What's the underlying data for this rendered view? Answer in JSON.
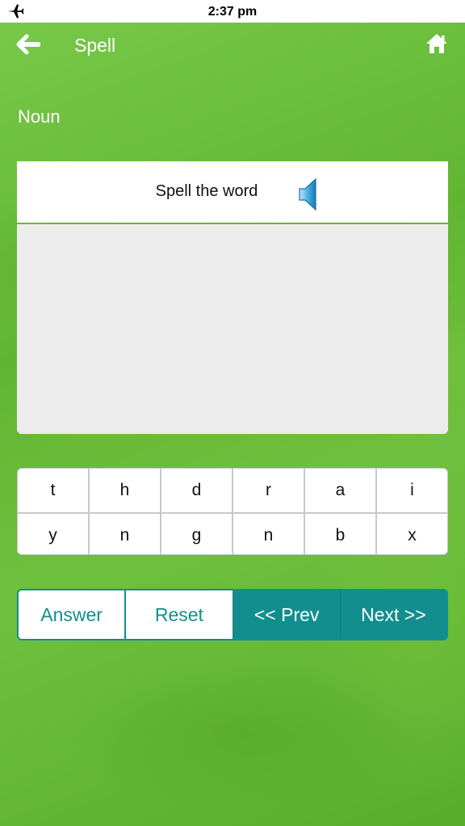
{
  "status_bar": {
    "time": "2:37 pm",
    "mode_icon": "airplane-icon"
  },
  "header": {
    "title": "Spell",
    "back_icon": "arrow-left-icon",
    "home_icon": "home-icon"
  },
  "part_of_speech": "Noun",
  "prompt": {
    "text": "Spell the word",
    "audio_icon": "speaker-icon"
  },
  "letters": [
    "t",
    "h",
    "d",
    "r",
    "a",
    "i",
    "y",
    "n",
    "g",
    "n",
    "b",
    "x"
  ],
  "actions": {
    "answer": "Answer",
    "reset": "Reset",
    "prev": "<< Prev",
    "next": "Next >>"
  },
  "colors": {
    "background_green": "#6cbd3c",
    "accent_teal": "#138e8e",
    "answer_area": "#ececec"
  }
}
